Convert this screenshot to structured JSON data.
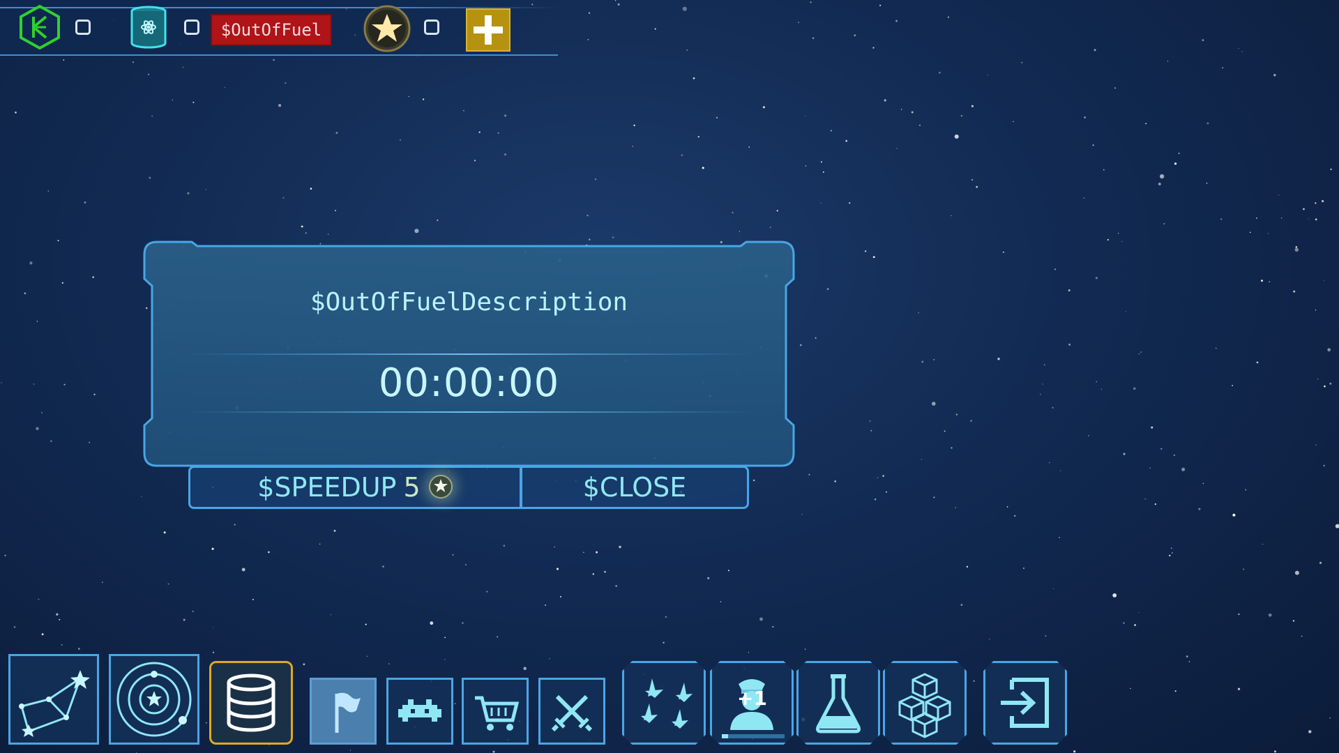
{
  "resources": {
    "credits_value": "",
    "fuel_value": "",
    "fuel_warning": "$OutOfFuel",
    "stars_value": ""
  },
  "dialog": {
    "description": "$OutOfFuelDescription",
    "timer": "00:00:00",
    "speedup_label": "$SPEEDUP",
    "speedup_cost": "5",
    "close_label": "$CLOSE"
  },
  "toolbar": {
    "captain_badge": "+1",
    "captain_progress": 0.1
  },
  "colors": {
    "accent": "#4aa6e6",
    "text_cyan": "#8fe7f4",
    "warning_red": "#b01318",
    "gold": "#b5920f",
    "credits_green": "#2fd12f"
  },
  "icons": {
    "top": [
      "credits-hex-icon",
      "fuel-canister-icon",
      "star-coin-icon",
      "plus-icon"
    ],
    "bottom": [
      "constellation-icon",
      "solar-system-icon",
      "fuel-storage-icon",
      "flag-icon",
      "invader-icon",
      "cart-icon",
      "crossed-swords-icon",
      "fleet-icon",
      "captain-icon",
      "flask-icon",
      "cargo-boxes-icon",
      "exit-icon"
    ]
  }
}
